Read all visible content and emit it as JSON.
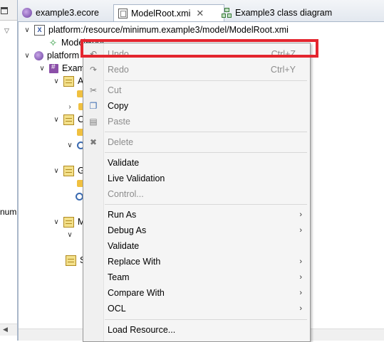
{
  "colors": {
    "highlight": "#e4262f",
    "accent": "#a9b7c9"
  },
  "left_panel": {
    "partial_label": "num"
  },
  "tabs": [
    {
      "label": "example3.ecore",
      "icon": "ecore-icon",
      "active": false
    },
    {
      "label": "ModelRoot.xmi",
      "icon": "xmi-file-icon",
      "active": true,
      "close": "✕"
    },
    {
      "label": "Example3 class diagram",
      "icon": "diagram-icon",
      "active": false
    }
  ],
  "tree": {
    "resource_xmi": "platform:/resource/minimum.example3/model/ModelRoot.xmi",
    "model_root": "ModelRoot",
    "resource_ecore": "platform",
    "package": "Exam",
    "class_a": "A",
    "class_c": "C",
    "class_g": "G",
    "class_m": "M",
    "class_s": "S"
  },
  "menu": {
    "undo": {
      "label": "Undo",
      "shortcut": "Ctrl+Z"
    },
    "redo": {
      "label": "Redo",
      "shortcut": "Ctrl+Y"
    },
    "cut": "Cut",
    "copy": "Copy",
    "paste": "Paste",
    "delete": "Delete",
    "validate": "Validate",
    "live_validation": "Live Validation",
    "control": "Control...",
    "run_as": "Run As",
    "debug_as": "Debug As",
    "validate2": "Validate",
    "replace_with": "Replace With",
    "team": "Team",
    "compare_with": "Compare With",
    "ocl": "OCL",
    "load_resource": "Load Resource..."
  }
}
